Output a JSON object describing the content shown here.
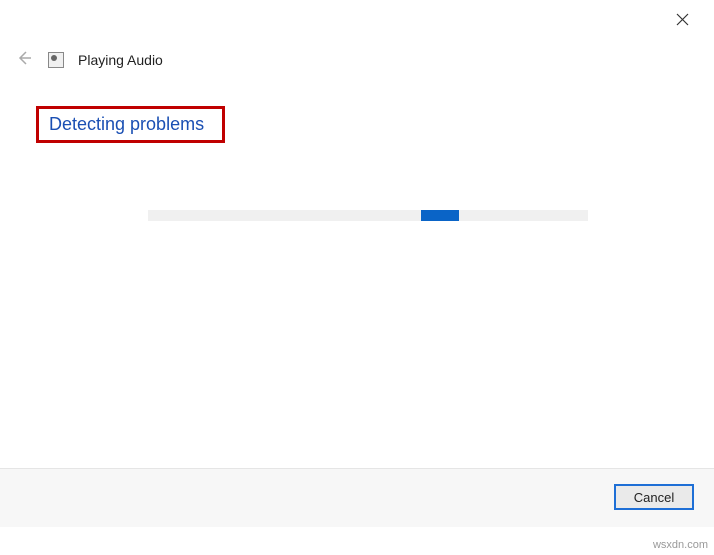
{
  "window": {
    "title": "Playing Audio"
  },
  "content": {
    "status": "Detecting problems"
  },
  "footer": {
    "cancel_label": "Cancel"
  },
  "watermark": "wsxdn.com"
}
